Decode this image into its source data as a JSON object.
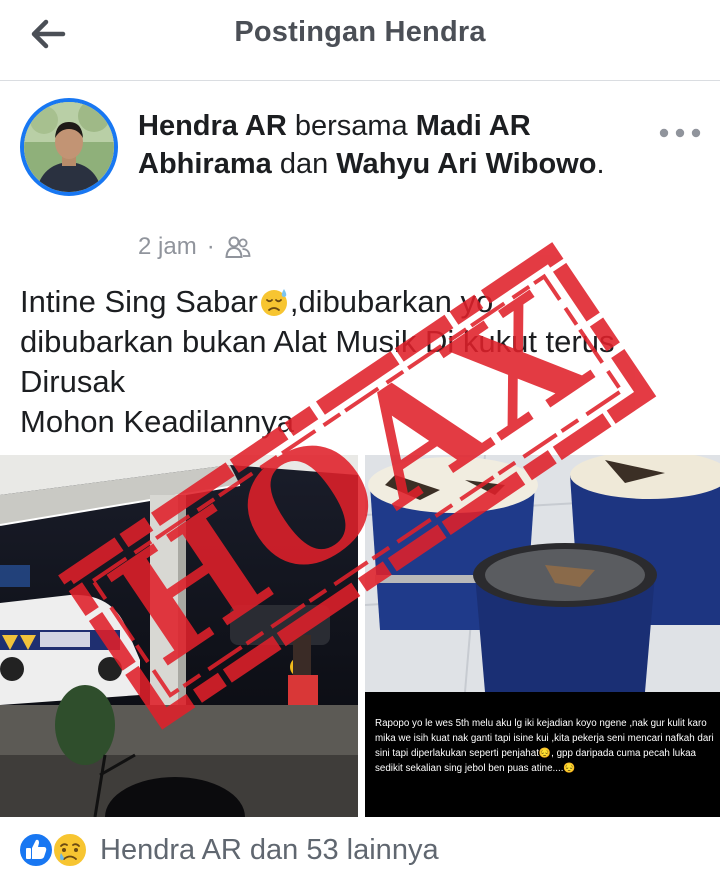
{
  "header": {
    "title": "Postingan Hendra",
    "back_icon": "arrow-left-icon"
  },
  "post": {
    "author": "Hendra AR",
    "with_word": " bersama ",
    "tagged_1": "Madi AR Abhirama",
    "and_word": " dan ",
    "tagged_2": "Wahyu Ari Wibowo",
    "period": ".",
    "time": "2 jam",
    "separator": "·",
    "audience_icon": "friends-icon",
    "more_icon": "more-options-icon",
    "text_line1_a": "Intine Sing Sabar",
    "text_line1_b": ",dibubarkan yo",
    "text_line2": "dibubarkan  bukan Alat Musik Di kukut terus",
    "text_line3": "Dirusak",
    "text_line4": "Mohon Keadilannya",
    "emoji_1": "sad-sweat-emoji-icon",
    "image_caption": "Rapopo yo le wes 5th melu aku lg iki kejadian koyo ngene ,nak gur kulit karo mika we isih kuat nak ganti tapi isine kui ,kita pekerja seni mencari nafkah dari sini tapi diperlakukan seperti penjahat😔, gpp daripada cuma pecah lukaa sedikit sekalian sing jebol ben puas atine....😔"
  },
  "reactions": {
    "like_icon": "like-reaction-icon",
    "sad_icon": "sad-reaction-icon",
    "text": "Hendra AR dan 53 lainnya"
  },
  "stamp": {
    "text": "HOAX",
    "color": "#e0202a"
  },
  "colors": {
    "accent": "#1877f2",
    "muted": "#90949c"
  }
}
